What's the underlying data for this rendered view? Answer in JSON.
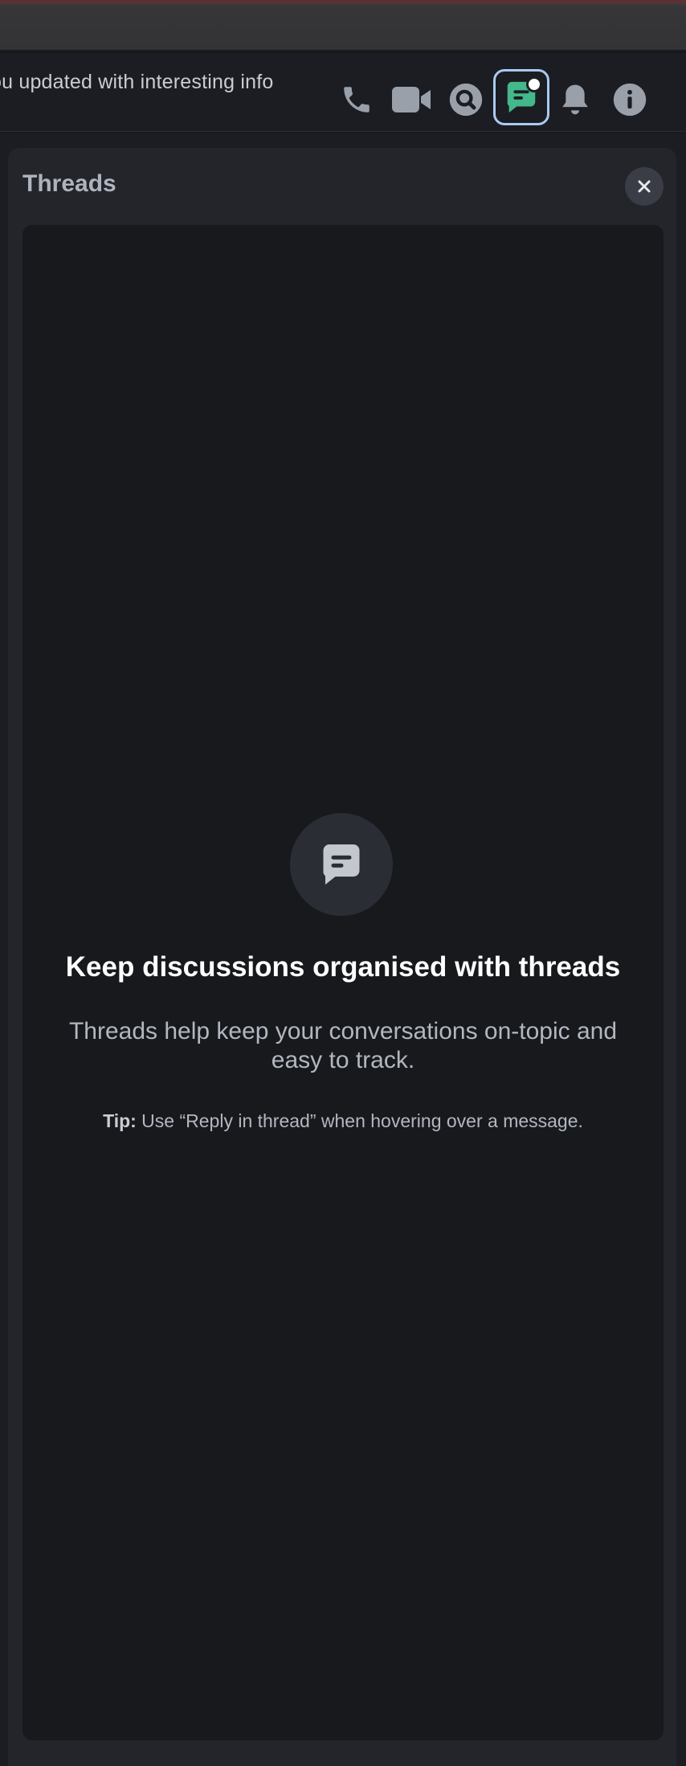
{
  "header": {
    "topic": "ou updated with interesting info",
    "icons": [
      "phone-icon",
      "video-icon",
      "search-icon",
      "threads-icon",
      "bell-icon",
      "info-icon"
    ],
    "threads_accent": "#44b78b",
    "focus_ring": "#a9c9f2"
  },
  "panel": {
    "title": "Threads",
    "close_icon": "close-icon",
    "empty_state": {
      "icon": "thread-bubble-icon",
      "title": "Keep discussions organised with threads",
      "description": "Threads help keep your conversations on-topic and easy to track.",
      "tip_label": "Tip:",
      "tip_text": " Use “Reply in thread” when hovering over a message."
    }
  }
}
